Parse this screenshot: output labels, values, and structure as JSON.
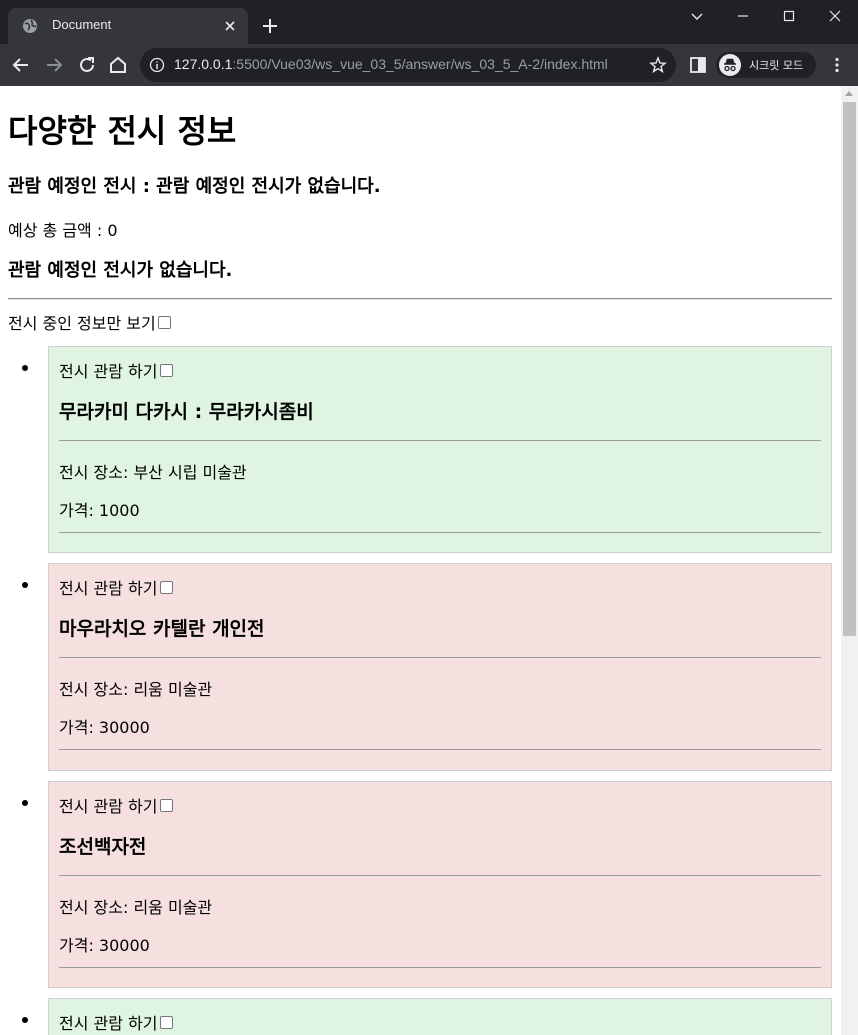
{
  "browser": {
    "tab_title": "Document",
    "url_host": "127.0.0.1",
    "url_path": ":5500/Vue03/ws_vue_03_5/answer/ws_03_5_A-2/index.html",
    "incognito_label": "시크릿 모드"
  },
  "page": {
    "title": "다양한 전시 정보",
    "planned_text": "관람 예정인 전시 : 관람 예정인 전시가 없습니다.",
    "total_text": "예상 총 금액 : 0",
    "empty_text": "관람 예정인 전시가 없습니다.",
    "filter_label": "전시 중인 정보만 보기",
    "filter_checked": false
  },
  "exhibitions": [
    {
      "watch_label": "전시 관람 하기",
      "name": "무라카미 다카시 : 무라카시좀비",
      "place": "전시 장소: 부산 시립 미술관",
      "price": "가격: 1000",
      "status_color": "#dff5e1"
    },
    {
      "watch_label": "전시 관람 하기",
      "name": "마우라치오 카텔란 개인전",
      "place": "전시 장소: 리움 미술관",
      "price": "가격: 30000",
      "status_color": "#f6e0df"
    },
    {
      "watch_label": "전시 관람 하기",
      "name": "조선백자전",
      "place": "전시 장소: 리움 미술관",
      "price": "가격: 30000",
      "status_color": "#f6e0df"
    },
    {
      "watch_label": "전시 관람 하기",
      "status_color": "#dff5e1"
    }
  ]
}
